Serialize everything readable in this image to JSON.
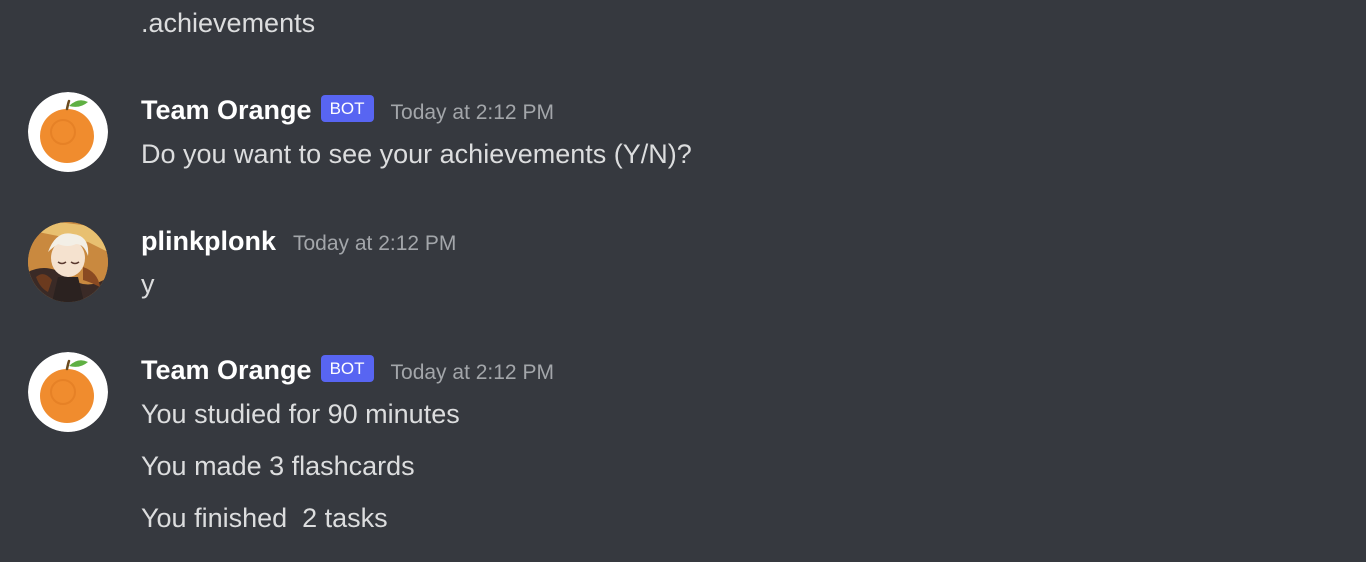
{
  "continuation_message": ".achievements",
  "messages": [
    {
      "author": "Team Orange",
      "bot_tag": "BOT",
      "timestamp": "Today at 2:12 PM",
      "lines": [
        "Do you want to see your achievements (Y/N)?"
      ],
      "avatar": "orange-avatar"
    },
    {
      "author": "plinkplonk",
      "timestamp": "Today at 2:12 PM",
      "lines": [
        "y"
      ],
      "avatar": "anime-character-avatar"
    },
    {
      "author": "Team Orange",
      "bot_tag": "BOT",
      "timestamp": "Today at 2:12 PM",
      "lines": [
        "You studied for 90 minutes",
        "You made 3 flashcards",
        "You finished  2 tasks"
      ],
      "avatar": "orange-avatar"
    }
  ],
  "colors": {
    "background": "#36393f",
    "bot_tag": "#5865f2",
    "username": "#ffffff",
    "message_text": "#dcddde",
    "timestamp": "#a3a6aa"
  }
}
